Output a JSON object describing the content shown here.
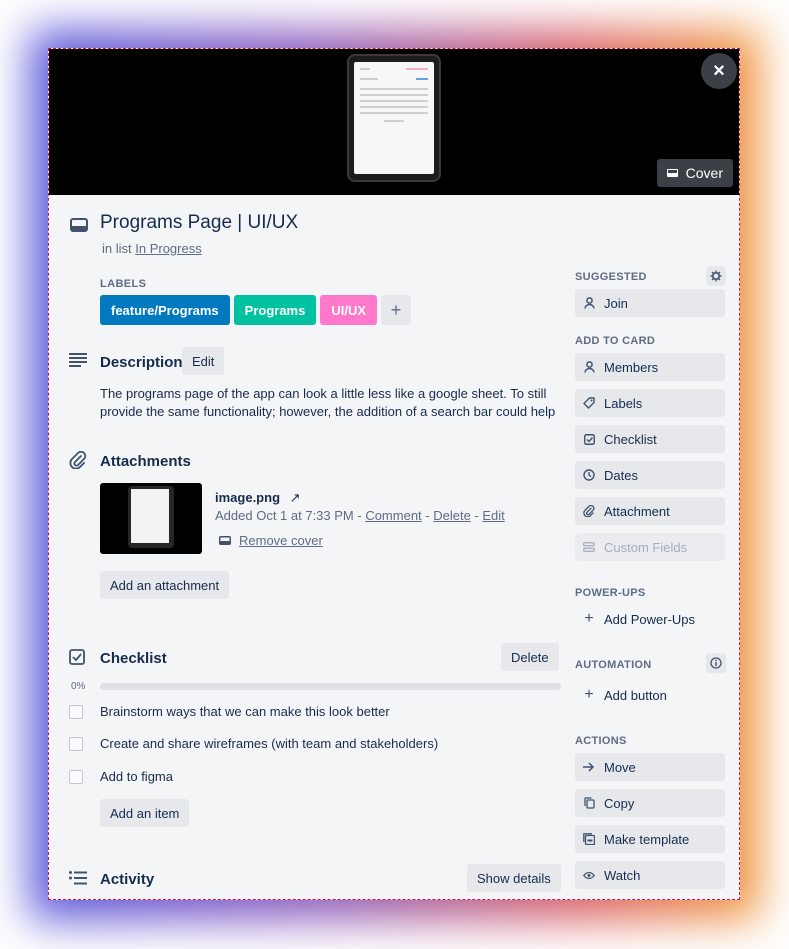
{
  "cover": {
    "button_label": "Cover",
    "close_glyph": "×"
  },
  "card": {
    "title": "Programs Page | UI/UX",
    "in_list_prefix": "in list",
    "list_name": "In Progress"
  },
  "labels": {
    "heading": "LABELS",
    "items": [
      {
        "text": "feature/Programs",
        "color": "#0079bf"
      },
      {
        "text": "Programs",
        "color": "#00c2a0"
      },
      {
        "text": "UI/UX",
        "color": "#ff78cb"
      }
    ],
    "add_glyph": "+"
  },
  "description": {
    "heading": "Description",
    "edit_label": "Edit",
    "text": "The programs page of the app can look a little less like a google sheet. To still provide the same functionality; however, the addition of a search bar could help"
  },
  "attachments": {
    "heading": "Attachments",
    "file_name": "image.png",
    "open_glyph": "↗",
    "added_text": "Added Oct 1 at 7:33 PM - ",
    "comment": "Comment",
    "sep": " - ",
    "delete": "Delete",
    "edit": "Edit",
    "remove_cover": "Remove cover",
    "add_button": "Add an attachment"
  },
  "checklist": {
    "heading": "Checklist",
    "delete_label": "Delete",
    "progress_text": "0%",
    "progress_value": 0,
    "items": [
      "Brainstorm ways that we can make this look better",
      "Create and share wireframes (with team and stakeholders)",
      "Add to figma"
    ],
    "add_item_label": "Add an item"
  },
  "activity": {
    "heading": "Activity",
    "show_details_label": "Show details"
  },
  "sidebar": {
    "suggested": {
      "heading": "SUGGESTED",
      "join": "Join"
    },
    "add_to_card": {
      "heading": "ADD TO CARD",
      "members": "Members",
      "labels": "Labels",
      "checklist": "Checklist",
      "dates": "Dates",
      "attachment": "Attachment",
      "custom_fields": "Custom Fields"
    },
    "power_ups": {
      "heading": "POWER-UPS",
      "add": "Add Power-Ups"
    },
    "automation": {
      "heading": "AUTOMATION",
      "add_button": "Add button"
    },
    "actions": {
      "heading": "ACTIONS",
      "move": "Move",
      "copy": "Copy",
      "make_template": "Make template",
      "watch": "Watch"
    }
  }
}
